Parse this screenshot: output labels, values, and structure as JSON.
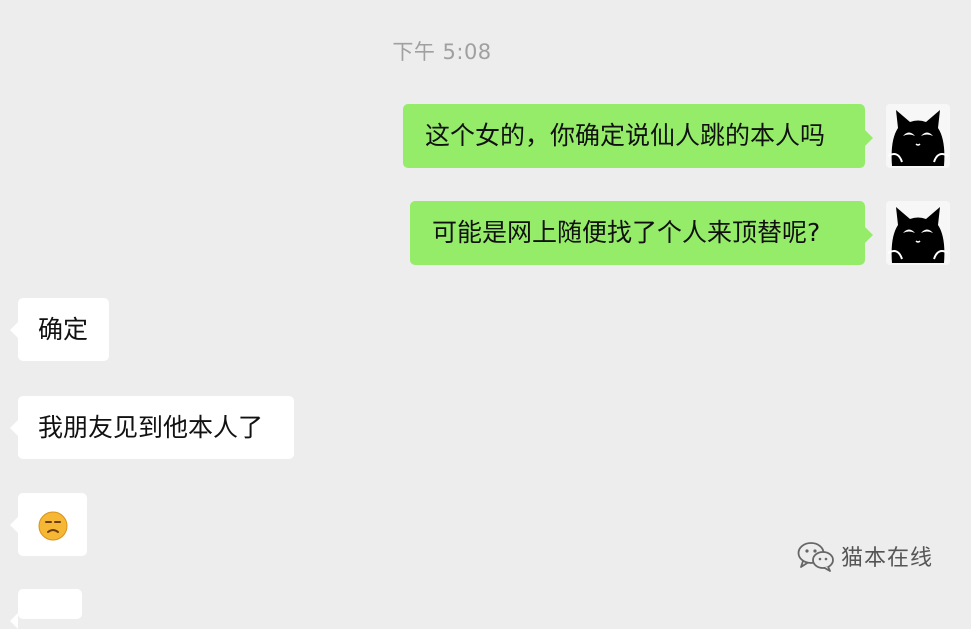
{
  "chat": {
    "timestamp": "下午 5:08",
    "messages": [
      {
        "side": "out",
        "text": "这个女的，你确定说仙人跳的本人吗"
      },
      {
        "side": "out",
        "text": "可能是网上随便找了个人来顶替呢?"
      },
      {
        "side": "in",
        "text": "确定"
      },
      {
        "side": "in",
        "text": "我朋友见到他本人了"
      },
      {
        "side": "in",
        "emoji": "frowning-face-emoji"
      }
    ]
  },
  "icons": {
    "my_avatar": "black-cat-avatar-icon",
    "watermark_logo": "wechat-logo-icon"
  },
  "watermark": {
    "text": "猫本在线"
  },
  "colors": {
    "background": "#ededed",
    "outgoing_bubble": "#95ec69",
    "incoming_bubble": "#ffffff",
    "timestamp_text": "#a0a0a0"
  }
}
